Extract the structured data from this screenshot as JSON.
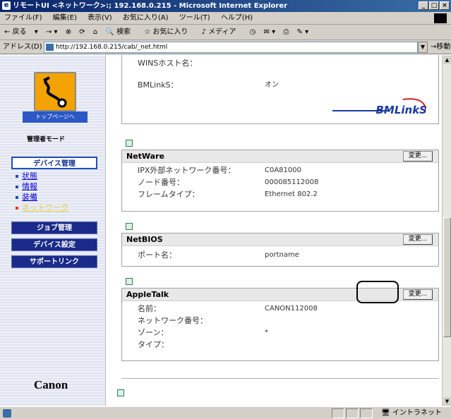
{
  "window": {
    "title": "リモートUI <ネットワーク>:; 192.168.0.215 - Microsoft Internet Explorer",
    "controls": [
      "_",
      "□",
      "×"
    ]
  },
  "menubar": [
    "ファイル(F)",
    "編集(E)",
    "表示(V)",
    "お気に入り(A)",
    "ツール(T)",
    "ヘルプ(H)"
  ],
  "toolbar": {
    "back": "戻る",
    "search": "検索",
    "favorites": "お気に入り",
    "media": "メディア"
  },
  "address": {
    "label": "アドレス(D)",
    "url": "http://192.168.0.215/cab/_net.html",
    "go": "移動"
  },
  "sidebar": {
    "top_button": "トップページへ",
    "mode": "管理者モード",
    "device_mgmt": "デバイス管理",
    "items": [
      {
        "label": "状態",
        "current": false
      },
      {
        "label": "情報",
        "current": false
      },
      {
        "label": "装備",
        "current": false
      },
      {
        "label": "ネットワーク",
        "current": true
      }
    ],
    "job_mgmt": "ジョブ管理",
    "device_settings": "デバイス設定",
    "support_link": "サポートリンク",
    "brand": "Canon"
  },
  "top_section": {
    "wins_label": "WINSホスト名：",
    "bmlinks_label": "BMLinkS：",
    "bmlinks_value": "オン",
    "bmlinks_logo": "BMLinkS"
  },
  "netware": {
    "title": "NetWare",
    "change": "変更...",
    "rows": [
      {
        "k": "IPX外部ネットワーク番号：",
        "v": "C0A81000"
      },
      {
        "k": "ノード番号：",
        "v": "000085112008"
      },
      {
        "k": "フレームタイプ：",
        "v": "Ethernet 802.2"
      }
    ]
  },
  "netbios": {
    "title": "NetBIOS",
    "change": "変更...",
    "rows": [
      {
        "k": "ポート名：",
        "v": "portname"
      }
    ]
  },
  "appletalk": {
    "title": "AppleTalk",
    "change": "変更...",
    "rows": [
      {
        "k": "名前：",
        "v": "CANON112008"
      },
      {
        "k": "ネットワーク番号：",
        "v": ""
      },
      {
        "k": "ゾーン：",
        "v": "*"
      },
      {
        "k": "タイプ：",
        "v": ""
      }
    ]
  },
  "status": {
    "zone": "イントラネット"
  }
}
